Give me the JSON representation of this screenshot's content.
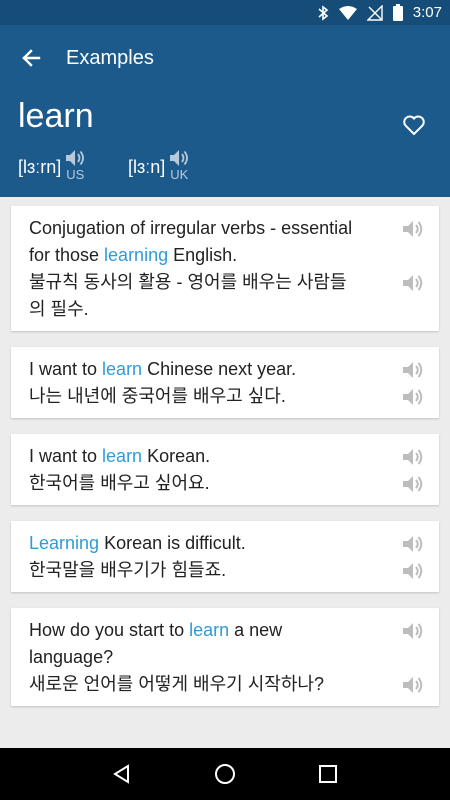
{
  "status_bar": {
    "time": "3:07",
    "icons": [
      "bluetooth-icon",
      "wifi-icon",
      "no-signal-icon",
      "battery-icon"
    ]
  },
  "app_bar": {
    "title": "Examples"
  },
  "header": {
    "word": "learn",
    "pronunciations": [
      {
        "ipa": "[lɜːrn]",
        "region": "US"
      },
      {
        "ipa": "[lɜːn]",
        "region": "UK"
      }
    ]
  },
  "examples": [
    {
      "english": [
        "Conjugation of irregular verbs - essential",
        {
          "pre": "for those ",
          "hl": "learning",
          "post": " English."
        }
      ],
      "korean": [
        "불규칙 동사의 활용 - 영어를 배우는 사람들",
        "의 필수."
      ]
    },
    {
      "english": [
        {
          "pre": "I want to ",
          "hl": "learn",
          "post": " Chinese next year."
        }
      ],
      "korean": [
        "나는 내년에 중국어를 배우고 싶다."
      ]
    },
    {
      "english": [
        {
          "pre": "I want to ",
          "hl": "learn",
          "post": " Korean."
        }
      ],
      "korean": [
        "한국어를 배우고 싶어요."
      ]
    },
    {
      "english": [
        {
          "pre": "",
          "hl": "Learning",
          "post": " Korean is difficult."
        }
      ],
      "korean": [
        "한국말을 배우기가 힘들죠."
      ]
    },
    {
      "english": [
        {
          "pre": "How do you start to ",
          "hl": "learn",
          "post": " a new"
        },
        "language?"
      ],
      "korean": [
        "새로운 언어를 어떻게 배우기 시작하나?"
      ]
    }
  ],
  "colors": {
    "app_bar": "#1c5a8c",
    "status_bar": "#164d78",
    "highlight": "#2f9bd8",
    "background": "#ececec"
  }
}
